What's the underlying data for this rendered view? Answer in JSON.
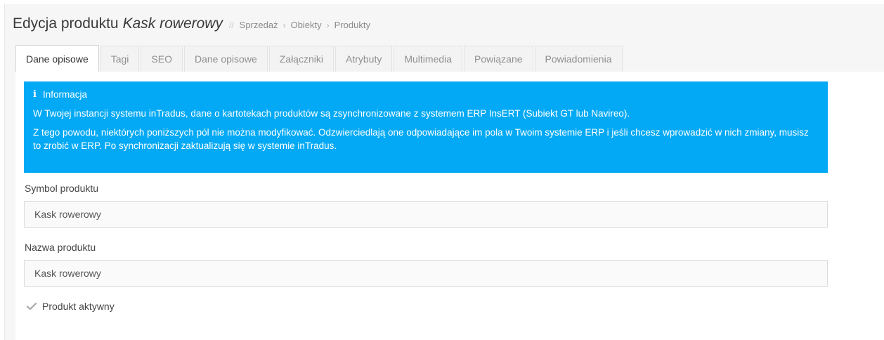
{
  "header": {
    "title": "Edycja produktu",
    "product_name": "Kask rowerowy",
    "separator": "//",
    "breadcrumb": [
      "Sprzedaż",
      "Obiekty",
      "Produkty"
    ],
    "crumb_arrow": "›"
  },
  "tabs": [
    {
      "label": "Dane opisowe",
      "active": true
    },
    {
      "label": "Tagi"
    },
    {
      "label": "SEO"
    },
    {
      "label": "Dane opisowe"
    },
    {
      "label": "Załączniki"
    },
    {
      "label": "Atrybuty"
    },
    {
      "label": "Multimedia"
    },
    {
      "label": "Powiązane"
    },
    {
      "label": "Powiadomienia"
    }
  ],
  "alert": {
    "icon": "info-icon",
    "icon_glyph": "i",
    "title": "Informacja",
    "line1": "W Twojej instancji systemu inTradus, dane o kartotekach produktów są zsynchronizowane z systemem ERP InsERT (Subiekt GT lub Navireo).",
    "line2": "Z tego powodu, niektórych poniższych pól nie można modyfikować. Odzwierciedlają one odpowiadające im pola w Twoim systemie ERP i jeśli chcesz wprowadzić w nich zmiany, musisz to zrobić w ERP. Po synchronizacji zaktualizują się w systemie inTradus.",
    "color": "#03a9f4"
  },
  "form": {
    "symbol_label": "Symbol produktu",
    "symbol_value": "Kask rowerowy",
    "name_label": "Nazwa produktu",
    "name_value": "Kask rowerowy",
    "active_label": "Produkt aktywny",
    "active_checked": true
  }
}
